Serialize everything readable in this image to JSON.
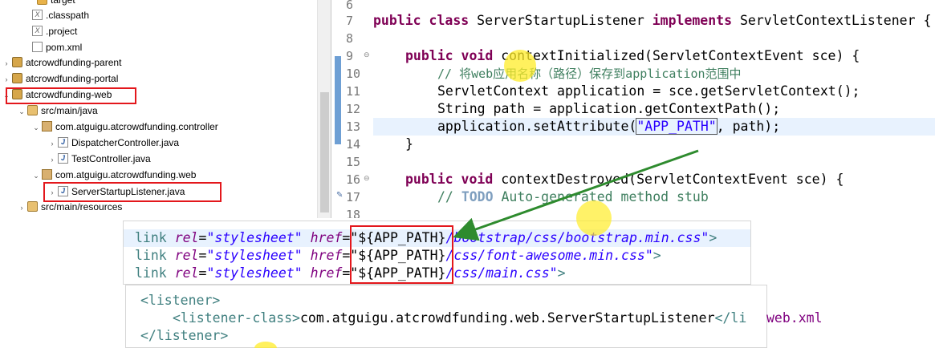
{
  "tree": {
    "items": [
      {
        "label": "target",
        "indent": 0
      },
      {
        "label": ".classpath"
      },
      {
        "label": ".project"
      },
      {
        "label": "pom.xml"
      },
      {
        "label": "atcrowdfunding-parent"
      },
      {
        "label": "atcrowdfunding-portal"
      },
      {
        "label": "atcrowdfunding-web"
      },
      {
        "label": "src/main/java"
      },
      {
        "label": "com.atguigu.atcrowdfunding.controller"
      },
      {
        "label": "DispatcherController.java"
      },
      {
        "label": "TestController.java"
      },
      {
        "label": "com.atguigu.atcrowdfunding.web"
      },
      {
        "label": "ServerStartupListener.java"
      },
      {
        "label": "src/main/resources"
      }
    ]
  },
  "editor": {
    "line_numbers": [
      "6",
      "7",
      "8",
      "9",
      "10",
      "11",
      "12",
      "13",
      "14",
      "15",
      "16",
      "17",
      "18"
    ],
    "line7": {
      "kw1": "public",
      "kw2": "class",
      "name": " ServerStartupListener ",
      "kw3": "implements",
      "iface": " ServletContextListener {"
    },
    "line9": {
      "kw1": "public",
      "kw2": "void",
      "rest": " contextInitialized(ServletContextEvent sce) {"
    },
    "line10": {
      "comment": "// 将web应用名称（路径）保存到application范围中"
    },
    "line11": {
      "text": "ServletContext application = sce.getServletContext();"
    },
    "line12": {
      "text": "String path = application.getContextPath();"
    },
    "line13": {
      "pre": "application.setAttribute(",
      "str": "\"APP_PATH\"",
      "post": ", path);"
    },
    "line14": {
      "text": "}"
    },
    "line16": {
      "kw1": "public",
      "kw2": "void",
      "rest": " contextDestroyed(ServletContextEvent sce) {"
    },
    "line17": {
      "comment_pre": "// ",
      "todo": "TODO",
      "comment_post": " Auto-generated method stub"
    }
  },
  "jsp": {
    "rows": [
      {
        "tag": "link",
        "attr1": "rel",
        "val1": "\"stylesheet\"",
        "attr2": "href",
        "val2a": "\"${APP_PATH}",
        "val2b": "/bootstrap/css/bootstrap.min.css\"",
        "close": ">"
      },
      {
        "tag": "link",
        "attr1": "rel",
        "val1": "\"stylesheet\"",
        "attr2": "href",
        "val2a": "\"${APP_PATH}",
        "val2b": "/css/font-awesome.min.css\"",
        "close": ">"
      },
      {
        "tag": "link",
        "attr1": "rel",
        "val1": "\"stylesheet\"",
        "attr2": "href",
        "val2a": "\"${APP_PATH}",
        "val2b": "/css/main.css\"",
        "close": ">"
      }
    ]
  },
  "xml": {
    "open": "<listener>",
    "inner_open": "<listener-class>",
    "inner_text": "com.atguigu.atcrowdfunding.web.ServerStartupListener",
    "inner_close": "</li",
    "close": "</listener>",
    "filename": "web.xml"
  },
  "colors": {
    "annotation_red": "#e3171c",
    "arrow_green": "#2e8b2e",
    "cursor_highlight": "#ffec28"
  }
}
